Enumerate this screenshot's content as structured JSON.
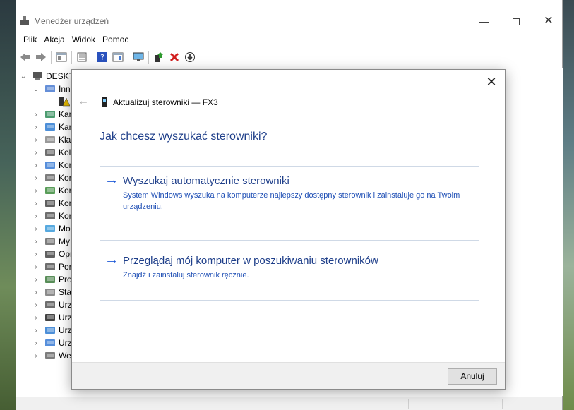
{
  "window": {
    "title": "Menedżer urządzeń",
    "minimize_glyph": "—",
    "close_glyph": "✕"
  },
  "menu": [
    "Plik",
    "Akcja",
    "Widok",
    "Pomoc"
  ],
  "toolbar_icons": [
    "back-icon",
    "forward-icon",
    "properties-icon",
    "show-hidden-icon",
    "help-icon",
    "action-icon",
    "monitor-icon",
    "update-driver-icon",
    "uninstall-icon",
    "disable-icon"
  ],
  "tree": {
    "root": "DESKTO",
    "items": [
      {
        "label": "Inn",
        "icon": "other-devices-icon",
        "color": "#4a7bd1"
      },
      {
        "label": "",
        "icon": "warning-device-icon",
        "color": "#e3b800"
      },
      {
        "label": "Kar",
        "icon": "display-adapter-icon",
        "color": "#2e8b57"
      },
      {
        "label": "Kar",
        "icon": "network-adapter-icon",
        "color": "#2e7bd1"
      },
      {
        "label": "Klav",
        "icon": "keyboard-icon",
        "color": "#888888"
      },
      {
        "label": "Kol",
        "icon": "print-queue-icon",
        "color": "#555555"
      },
      {
        "label": "Kor",
        "icon": "computer-icon",
        "color": "#3a7bd5"
      },
      {
        "label": "Kor",
        "icon": "audio-icon",
        "color": "#666666"
      },
      {
        "label": "Kor",
        "icon": "storage-controller-icon",
        "color": "#3c8c3c"
      },
      {
        "label": "Kor",
        "icon": "usb-controller-icon",
        "color": "#444444"
      },
      {
        "label": "Kor",
        "icon": "controller-icon",
        "color": "#555555"
      },
      {
        "label": "Mo",
        "icon": "monitor-icon",
        "color": "#3a9ad9"
      },
      {
        "label": "My",
        "icon": "mouse-icon",
        "color": "#666666"
      },
      {
        "label": "Opr",
        "icon": "firmware-icon",
        "color": "#444444"
      },
      {
        "label": "Por",
        "icon": "ports-icon",
        "color": "#555555"
      },
      {
        "label": "Pro",
        "icon": "processor-icon",
        "color": "#3c7a3c"
      },
      {
        "label": "Sta",
        "icon": "disk-drive-icon",
        "color": "#777777"
      },
      {
        "label": "Urz",
        "icon": "hid-icon",
        "color": "#555555"
      },
      {
        "label": "Urz",
        "icon": "portable-device-icon",
        "color": "#222222"
      },
      {
        "label": "Urz",
        "icon": "software-device-icon",
        "color": "#2e7bd1"
      },
      {
        "label": "Urz",
        "icon": "system-device-icon",
        "color": "#3a7bd5"
      },
      {
        "label": "We",
        "icon": "audio-inputs-icon",
        "color": "#666666"
      }
    ]
  },
  "dialog": {
    "close_glyph": "✕",
    "back_glyph": "←",
    "header": "Aktualizuj sterowniki — FX3",
    "question": "Jak chcesz wyszukać sterowniki?",
    "options": [
      {
        "arrow": "→",
        "title": "Wyszukaj automatycznie sterowniki",
        "description": "System Windows wyszuka na komputerze najlepszy dostępny sterownik i zainstaluje go na Twoim urządzeniu."
      },
      {
        "arrow": "→",
        "title": "Przeglądaj mój komputer w poszukiwaniu sterowników",
        "description": "Znajdź i zainstaluj sterownik ręcznie."
      }
    ],
    "cancel_label": "Anuluj"
  }
}
